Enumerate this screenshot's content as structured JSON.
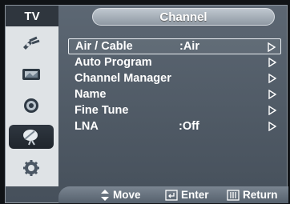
{
  "header": {
    "section": "TV",
    "title": "Channel"
  },
  "sidebar": {
    "items": [
      {
        "icon": "antenna-icon",
        "active": false
      },
      {
        "icon": "picture-icon",
        "active": false
      },
      {
        "icon": "sound-icon",
        "active": false
      },
      {
        "icon": "channel-dish-icon",
        "active": true
      },
      {
        "icon": "setup-gear-icon",
        "active": false
      }
    ]
  },
  "menu": {
    "items": [
      {
        "label": "Air / Cable",
        "value": ":Air",
        "selected": true
      },
      {
        "label": "Auto Program",
        "value": ""
      },
      {
        "label": "Channel Manager",
        "value": ""
      },
      {
        "label": "Name",
        "value": ""
      },
      {
        "label": "Fine Tune",
        "value": ""
      },
      {
        "label": "LNA",
        "value": ":Off"
      }
    ]
  },
  "footer": {
    "move": "Move",
    "enter": "Enter",
    "return": "Return"
  },
  "colors": {
    "osd_bg": "#4f5a65",
    "sidebar_bg": "#dfe3e6",
    "text": "#ffffff"
  }
}
